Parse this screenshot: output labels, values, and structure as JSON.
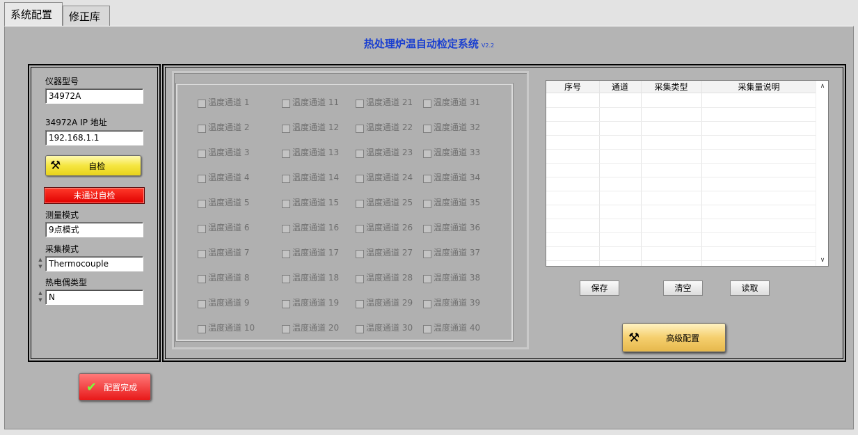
{
  "tabs": [
    {
      "label": "系统配置",
      "active": true
    },
    {
      "label": "修正库",
      "active": false
    }
  ],
  "title": "热处理炉温自动检定系统",
  "version": "V2.2",
  "left": {
    "instrument_label": "仪器型号",
    "instrument_value": "34972A",
    "ip_label": "34972A IP 地址",
    "ip_value": "192.168.1.1",
    "selftest_label": "自检",
    "selftest_status": "未通过自检",
    "measure_mode_label": "测量模式",
    "measure_mode_value": "9点模式",
    "acq_mode_label": "采集模式",
    "acq_mode_value": "Thermocouple",
    "tc_type_label": "热电偶类型",
    "tc_type_value": "N",
    "done_label": "配置完成"
  },
  "channels": [
    [
      "温度通道 1",
      "温度通道 2",
      "温度通道 3",
      "温度通道 4",
      "温度通道 5",
      "温度通道 6",
      "温度通道 7",
      "温度通道 8",
      "温度通道 9",
      "温度通道 10"
    ],
    [
      "温度通道 11",
      "温度通道 12",
      "温度通道 13",
      "温度通道 14",
      "温度通道 15",
      "温度通道 16",
      "温度通道 17",
      "温度通道 18",
      "温度通道 19",
      "温度通道 20"
    ],
    [
      "温度通道 21",
      "温度通道 22",
      "温度通道 23",
      "温度通道 24",
      "温度通道 25",
      "温度通道 26",
      "温度通道 27",
      "温度通道 28",
      "温度通道 29",
      "温度通道 30"
    ],
    [
      "温度通道 31",
      "温度通道 32",
      "温度通道 33",
      "温度通道 34",
      "温度通道 35",
      "温度通道 36",
      "温度通道 37",
      "温度通道 38",
      "温度通道 39",
      "温度通道 40"
    ]
  ],
  "table": {
    "columns": [
      "序号",
      "通道",
      "采集类型",
      "采集量说明"
    ]
  },
  "buttons": {
    "save": "保存",
    "clear": "清空",
    "read": "读取",
    "advanced": "高级配置"
  },
  "colors": {
    "title": "#1a3fd0",
    "panel_bg": "#b4b4b4",
    "status_red": "#e00000",
    "selftest_yellow": "#f5e640",
    "advanced_gold": "#f5cf6e"
  }
}
